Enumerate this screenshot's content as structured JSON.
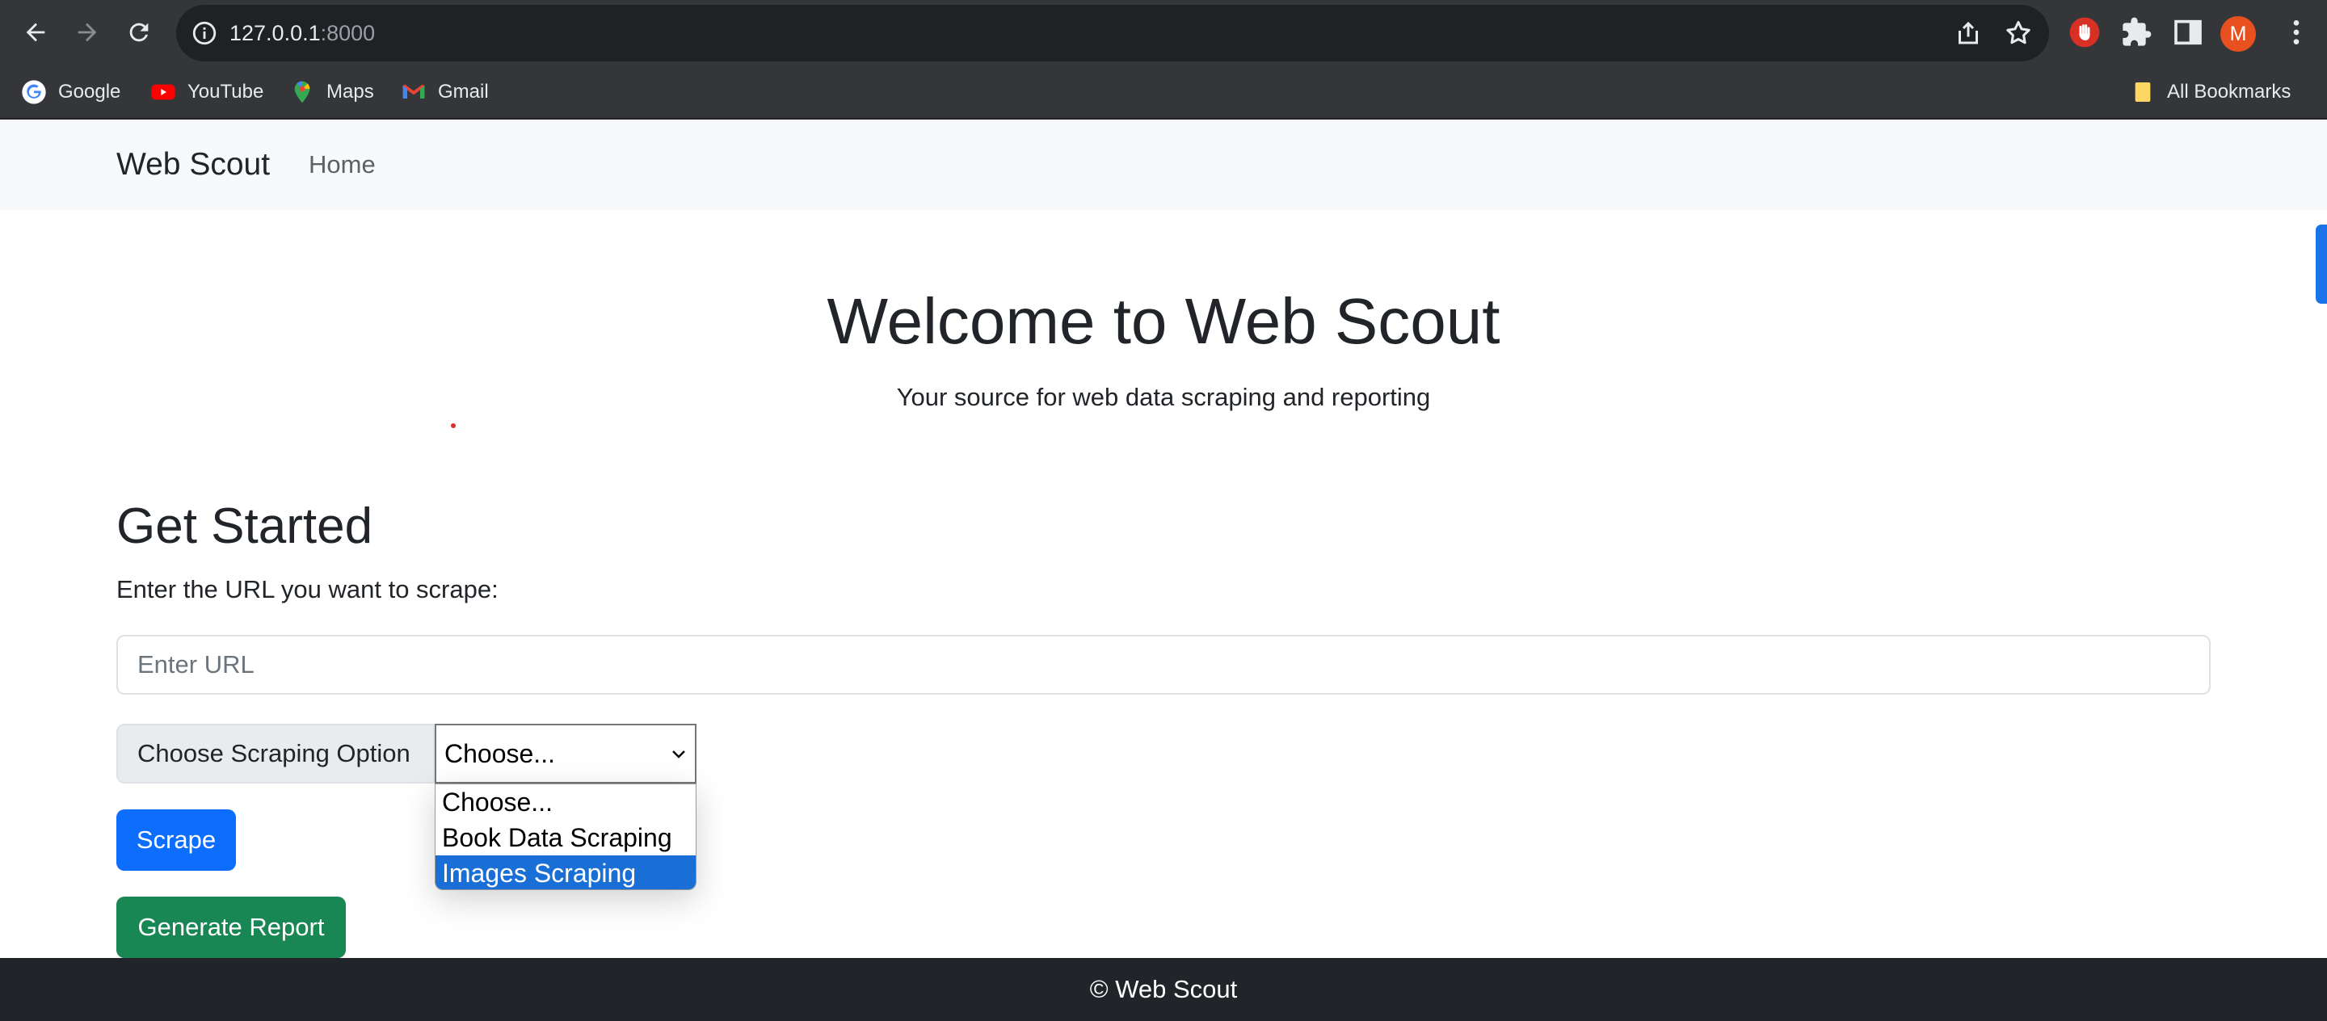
{
  "browser": {
    "url_host": "127.0.0.1",
    "url_port": ":8000",
    "profile_initial": "M",
    "bookmarks": [
      {
        "label": "Google",
        "icon": "google-icon"
      },
      {
        "label": "YouTube",
        "icon": "youtube-icon"
      },
      {
        "label": "Maps",
        "icon": "maps-icon"
      },
      {
        "label": "Gmail",
        "icon": "gmail-icon"
      }
    ],
    "all_bookmarks_label": "All Bookmarks"
  },
  "navbar": {
    "brand": "Web Scout",
    "links": [
      "Home"
    ]
  },
  "hero": {
    "title": "Welcome to Web Scout",
    "subtitle": "Your source for web data scraping and reporting"
  },
  "form": {
    "title": "Get Started",
    "url_label": "Enter the URL you want to scrape:",
    "url_placeholder": "Enter URL",
    "url_value": "",
    "option_label": "Choose Scraping Option",
    "select_value": "Choose...",
    "options": [
      "Choose...",
      "Book Data Scraping",
      "Images Scraping"
    ],
    "highlighted_option": "Images Scraping",
    "scrape_button": "Scrape",
    "report_button": "Generate Report"
  },
  "footer": {
    "text": "© Web Scout"
  },
  "colors": {
    "primary": "#0d6efd",
    "success": "#198754",
    "footer_bg": "#212529",
    "navbar_bg": "#f8f9fa",
    "dropdown_highlight": "#1a6fd6"
  }
}
